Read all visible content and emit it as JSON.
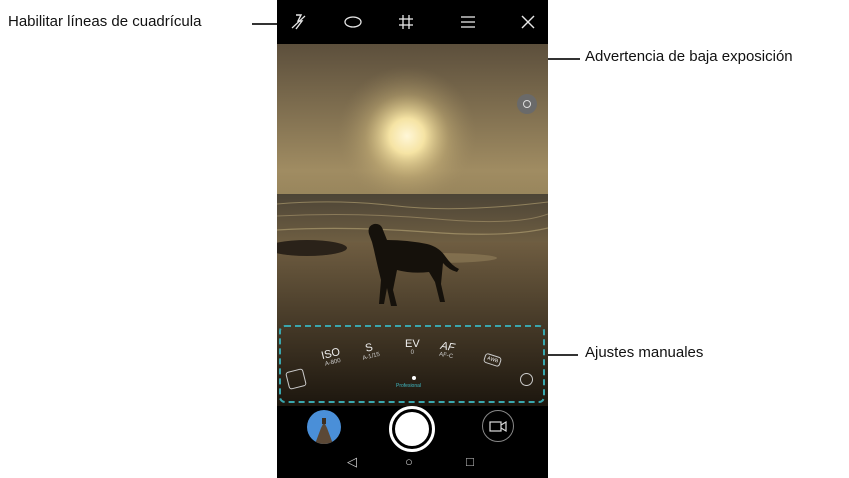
{
  "callouts": {
    "grid": "Habilitar líneas de cuadrícula",
    "exposure": "Advertencia de baja exposición",
    "manual": "Ajustes manuales"
  },
  "topbar": {
    "icons": [
      "flash-off-icon",
      "filter-icon",
      "grid-icon",
      "menu-icon",
      "close-icon"
    ]
  },
  "manual": {
    "iso": {
      "label": "ISO",
      "value": "A-800"
    },
    "shutter": {
      "label": "S",
      "value": "A-1/15"
    },
    "ev": {
      "label": "EV",
      "value": "0"
    },
    "af": {
      "label": "AF",
      "value": "AF-C"
    },
    "wb": {
      "label": "AWB"
    },
    "mode_label": "Profesional"
  },
  "colors": {
    "callout_box": "#39a6ad",
    "mode_label": "#3fb8c2"
  }
}
